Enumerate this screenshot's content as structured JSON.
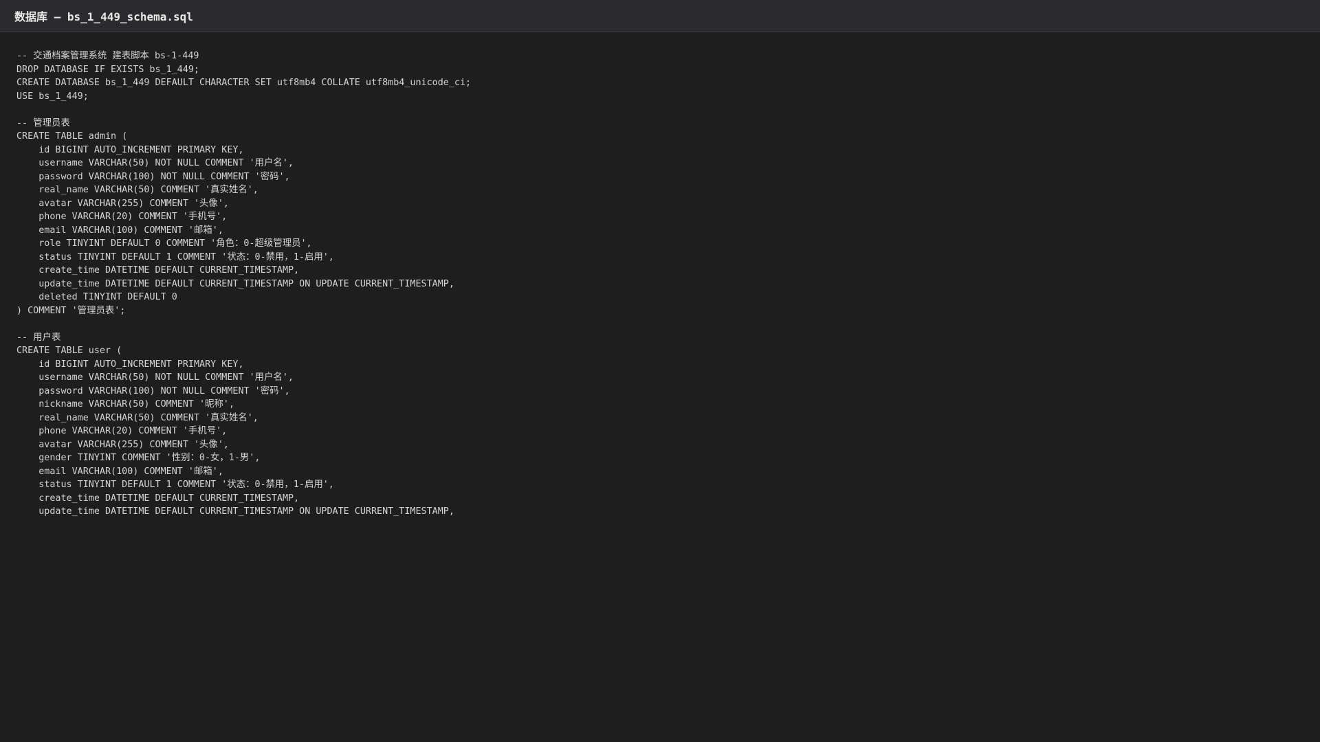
{
  "window": {
    "title": "数据库 — bs_1_449_schema.sql"
  },
  "editor": {
    "lines": [
      "-- 交通档案管理系统 建表脚本 bs-1-449",
      "DROP DATABASE IF EXISTS bs_1_449;",
      "CREATE DATABASE bs_1_449 DEFAULT CHARACTER SET utf8mb4 COLLATE utf8mb4_unicode_ci;",
      "USE bs_1_449;",
      "",
      "-- 管理员表",
      "CREATE TABLE admin (",
      "    id BIGINT AUTO_INCREMENT PRIMARY KEY,",
      "    username VARCHAR(50) NOT NULL COMMENT '用户名',",
      "    password VARCHAR(100) NOT NULL COMMENT '密码',",
      "    real_name VARCHAR(50) COMMENT '真实姓名',",
      "    avatar VARCHAR(255) COMMENT '头像',",
      "    phone VARCHAR(20) COMMENT '手机号',",
      "    email VARCHAR(100) COMMENT '邮箱',",
      "    role TINYINT DEFAULT 0 COMMENT '角色：0-超级管理员',",
      "    status TINYINT DEFAULT 1 COMMENT '状态：0-禁用，1-启用',",
      "    create_time DATETIME DEFAULT CURRENT_TIMESTAMP,",
      "    update_time DATETIME DEFAULT CURRENT_TIMESTAMP ON UPDATE CURRENT_TIMESTAMP,",
      "    deleted TINYINT DEFAULT 0",
      ") COMMENT '管理员表';",
      "",
      "-- 用户表",
      "CREATE TABLE user (",
      "    id BIGINT AUTO_INCREMENT PRIMARY KEY,",
      "    username VARCHAR(50) NOT NULL COMMENT '用户名',",
      "    password VARCHAR(100) NOT NULL COMMENT '密码',",
      "    nickname VARCHAR(50) COMMENT '昵称',",
      "    real_name VARCHAR(50) COMMENT '真实姓名',",
      "    phone VARCHAR(20) COMMENT '手机号',",
      "    avatar VARCHAR(255) COMMENT '头像',",
      "    gender TINYINT COMMENT '性别：0-女，1-男',",
      "    email VARCHAR(100) COMMENT '邮箱',",
      "    status TINYINT DEFAULT 1 COMMENT '状态：0-禁用，1-启用',",
      "    create_time DATETIME DEFAULT CURRENT_TIMESTAMP,",
      "    update_time DATETIME DEFAULT CURRENT_TIMESTAMP ON UPDATE CURRENT_TIMESTAMP,"
    ]
  }
}
